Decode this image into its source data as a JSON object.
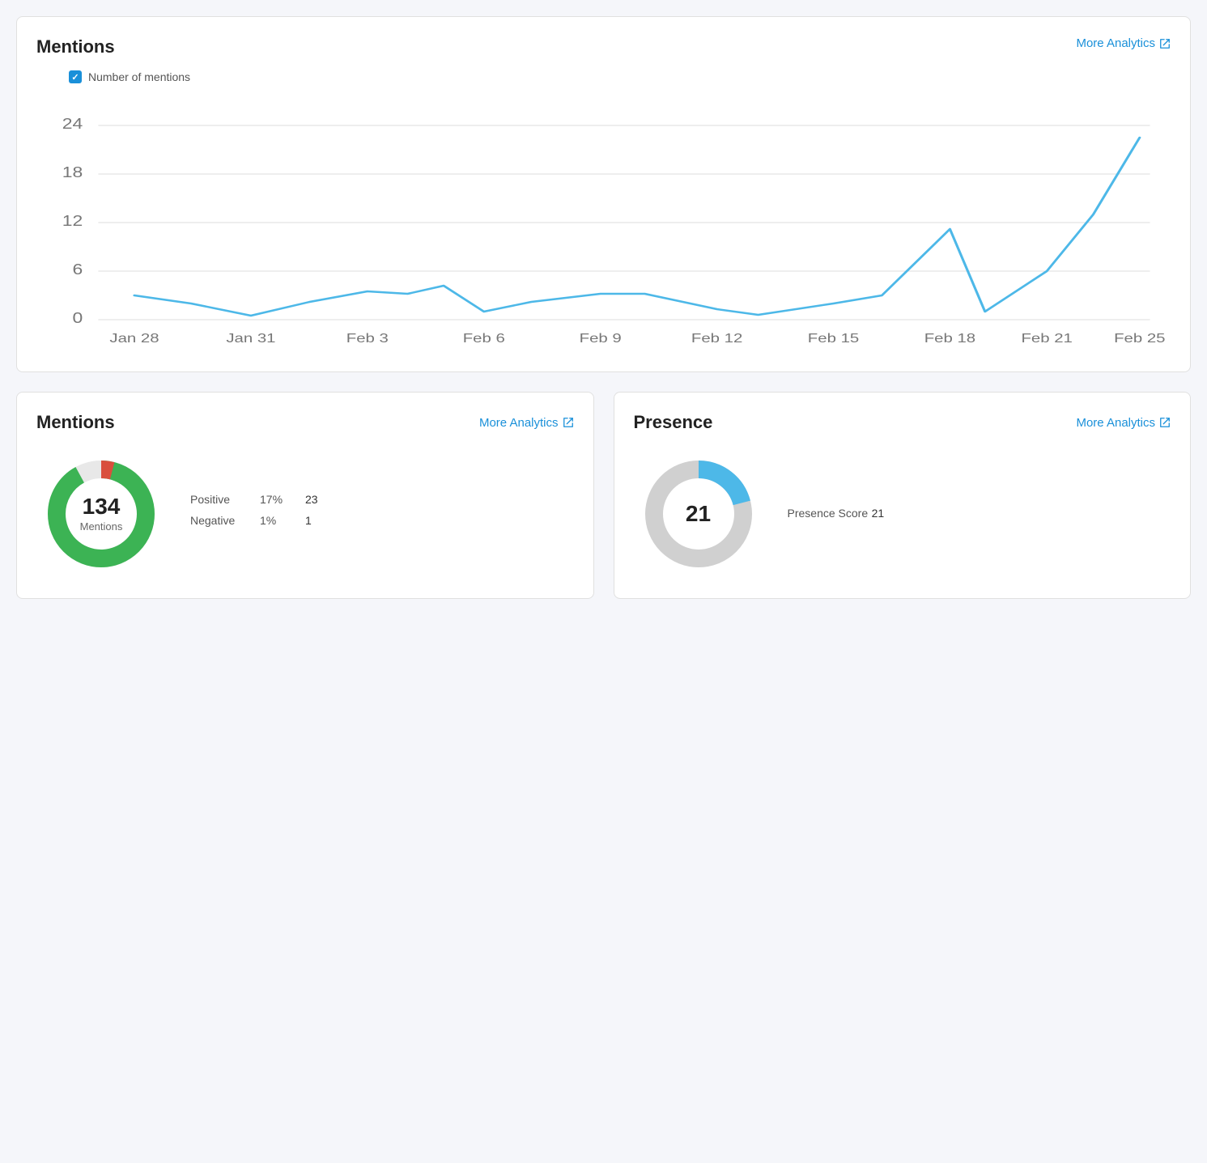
{
  "mentions_chart": {
    "title": "Mentions",
    "more_analytics_label": "More Analytics",
    "legend_label": "Number of mentions",
    "y_axis": [
      0,
      6,
      12,
      18,
      24
    ],
    "x_labels": [
      "Jan 28",
      "Jan 31",
      "Feb 3",
      "Feb 6",
      "Feb 9",
      "Feb 12",
      "Feb 15",
      "Feb 18",
      "Feb 21",
      "Feb 25"
    ],
    "data_points": [
      3,
      2,
      0.5,
      2.5,
      3.5,
      1,
      2,
      2.5,
      1.5,
      3.5,
      0.8,
      0.5,
      1.5,
      2,
      3.5,
      0.5,
      11,
      1,
      6,
      13,
      22,
      22.5
    ],
    "accent_color": "#4db8e8"
  },
  "mentions_donut": {
    "title": "Mentions",
    "more_analytics_label": "More Analytics",
    "total": "134",
    "total_label": "Mentions",
    "positive_label": "Positive",
    "positive_percent": "17%",
    "positive_count": "23",
    "negative_label": "Negative",
    "negative_percent": "1%",
    "negative_count": "1",
    "green_color": "#3cb354",
    "red_color": "#d94f3d",
    "neutral_color": "#e8e8e8"
  },
  "presence_donut": {
    "title": "Presence",
    "more_analytics_label": "More Analytics",
    "score": "21",
    "score_label": "Presence Score",
    "blue_color": "#4db8e8",
    "gray_color": "#d0d0d0"
  },
  "icons": {
    "external_link": "↗"
  }
}
